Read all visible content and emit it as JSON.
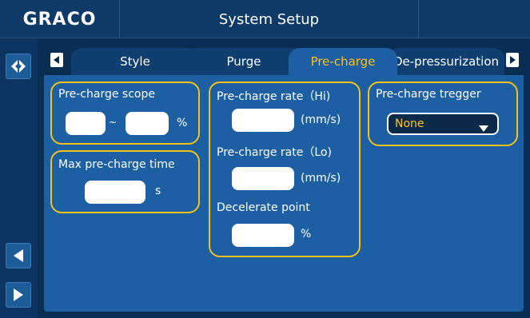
{
  "header": {
    "logo": "GRACO",
    "title": "System Setup"
  },
  "tabs": [
    {
      "label": "Style",
      "active": false
    },
    {
      "label": "Purge",
      "active": false
    },
    {
      "label": "Pre-charge",
      "active": true
    },
    {
      "label": "De-pressurization",
      "active": false
    }
  ],
  "precharge_scope": {
    "label": "Pre-charge scope",
    "min_value": "",
    "max_value": "",
    "separator": "~",
    "unit": "%"
  },
  "max_precharge_time": {
    "label": "Max pre-charge time",
    "value": "",
    "unit": "s"
  },
  "precharge_rate_hi": {
    "label": "Pre-charge rate（Hi)",
    "value": "",
    "unit": "(mm/s)"
  },
  "precharge_rate_lo": {
    "label": "Pre-charge rate（Lo)",
    "value": "",
    "unit": "(mm/s)"
  },
  "decelerate_point": {
    "label": "Decelerate point",
    "value": "",
    "unit": "%"
  },
  "precharge_trigger": {
    "label": "Pre-charge tregger",
    "selected": "None"
  },
  "colors": {
    "accent": "#f3c21a",
    "panel": "#1d5fa3",
    "background": "#0a2d52"
  }
}
